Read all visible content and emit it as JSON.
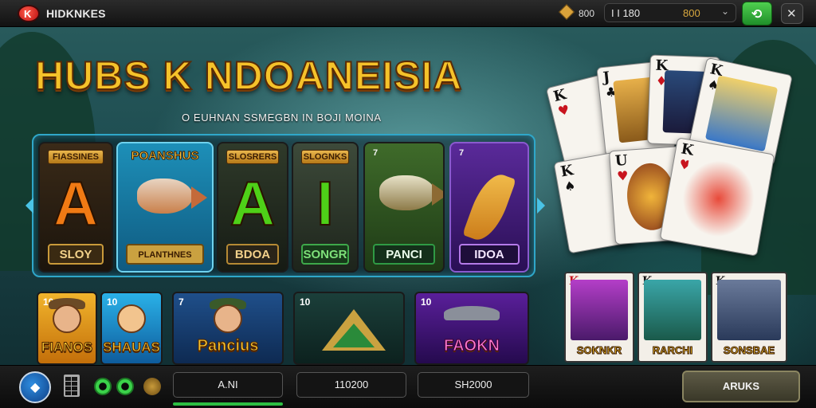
{
  "topbar": {
    "brand": "HIDKNKES",
    "logo_letter": "K",
    "coins": "800",
    "balance_left": "I I 180",
    "balance_right": "800",
    "icons": {
      "coins": "diamond-icon",
      "menu": "chevron-down-icon",
      "go": "arrow-icon",
      "settings": "tools-icon"
    }
  },
  "hero": {
    "title": "HUBS K NDOANEISIA",
    "subtitle": "O EUHNAN SSMEGBN IN BOJI MOINA"
  },
  "games_top": [
    {
      "banner": "FIASSINES",
      "letter": "A",
      "plate": "SLOY"
    },
    {
      "banner": "POANSHUS",
      "plate": "PLANTHNES"
    },
    {
      "banner": "SLOSRERS",
      "letter": "A",
      "plate": "BDOA"
    },
    {
      "banner": "SLOGNKS",
      "letter": "I",
      "plate": "SONGR"
    },
    {
      "corner": "7",
      "plate": "PANCI"
    },
    {
      "corner": "7",
      "plate": "IDOA"
    }
  ],
  "games_bottom": [
    {
      "corner": "10",
      "label": "FIANOS"
    },
    {
      "corner": "10",
      "label": "SHAUAS"
    },
    {
      "corner": "7",
      "label": "Pancius"
    },
    {
      "corner": "10",
      "label": ""
    },
    {
      "corner": "10",
      "label": "FAOKN"
    }
  ],
  "cards": [
    {
      "rank": "K",
      "suit": "♥"
    },
    {
      "rank": "J",
      "suit": "♣"
    },
    {
      "rank": "K",
      "suit": "♦"
    },
    {
      "rank": "K",
      "suit": "♠"
    },
    {
      "rank": "K",
      "suit": "♠"
    },
    {
      "rank": "U",
      "suit": "♥"
    },
    {
      "rank": "K",
      "suit": "♥"
    }
  ],
  "portrait_cards": [
    {
      "rank": "K",
      "name": "SOKNKR"
    },
    {
      "rank": "K",
      "name": "RARCHI"
    },
    {
      "rank": "K",
      "name": "SONSBAE"
    }
  ],
  "bottombar": {
    "field1": "A.NI",
    "field2": "110200",
    "field3": "SH2000",
    "cta": "ARUKS"
  },
  "colors": {
    "accent": "#2fa7c9",
    "gold": "#f5c22a",
    "green": "#2dbf43"
  }
}
